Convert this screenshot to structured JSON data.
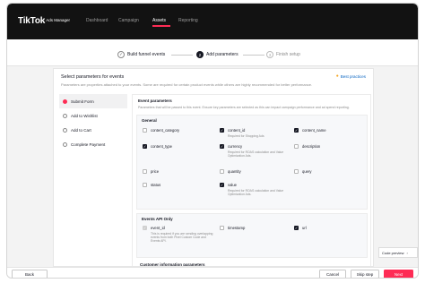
{
  "brand": {
    "logo": "TikTok",
    "sub": ": Ads Manager"
  },
  "nav": [
    "Dashboard",
    "Campaign",
    "Assets",
    "Reporting"
  ],
  "steps": [
    {
      "num": "✓",
      "label": "Build funnel events"
    },
    {
      "num": "2",
      "label": "Add parameters"
    },
    {
      "num": "3",
      "label": "Finish setup"
    }
  ],
  "panel": {
    "title": "Select parameters for events",
    "desc": "Parameters are properties attached to your events. Some are required for certain product events while others are highly recommended for better performance.",
    "best_practices": "Best practices"
  },
  "left_nav": [
    "Submit Form",
    "Add to Wishlist",
    "Add to Cart",
    "Complete Payment"
  ],
  "content": {
    "title": "Event parameters",
    "desc": "Parameters that will be passed to this event. Ensure key parameters are selected as this can impact campaign performance and ad spend reporting.",
    "general_label": "General",
    "general": [
      {
        "label": "content_category",
        "checked": false
      },
      {
        "label": "content_id",
        "checked": true,
        "note": "Required for Shopping Ads"
      },
      {
        "label": "content_name",
        "checked": true
      },
      {
        "label": "content_type",
        "checked": true
      },
      {
        "label": "currency",
        "checked": true,
        "note": "Required for ROAS calculation and Value Optimization Ads."
      },
      {
        "label": "description",
        "checked": false
      },
      {
        "label": "price",
        "checked": false
      },
      {
        "label": "quantity",
        "checked": false
      },
      {
        "label": "query",
        "checked": false
      },
      {
        "label": "status",
        "checked": false
      },
      {
        "label": "value",
        "checked": true,
        "note": "Required for ROAS calculation and Value Optimization Ads."
      }
    ],
    "api_label": "Events API Only",
    "api": [
      {
        "label": "event_id",
        "checked": "disabled",
        "note": "This is required if you are sending overlapping events from both Pixel Custom Code and Events API."
      },
      {
        "label": "timestamp",
        "checked": false
      },
      {
        "label": "url",
        "checked": true
      }
    ],
    "customer_label": "Customer information parameters"
  },
  "code_preview": "Code preview",
  "footer": {
    "back": "Back",
    "cancel": "Cancel",
    "skip": "Skip step",
    "next": "Next"
  },
  "colors": {
    "accent": "#fe2c55",
    "topbar": "#121212",
    "link": "#0a66c2"
  }
}
